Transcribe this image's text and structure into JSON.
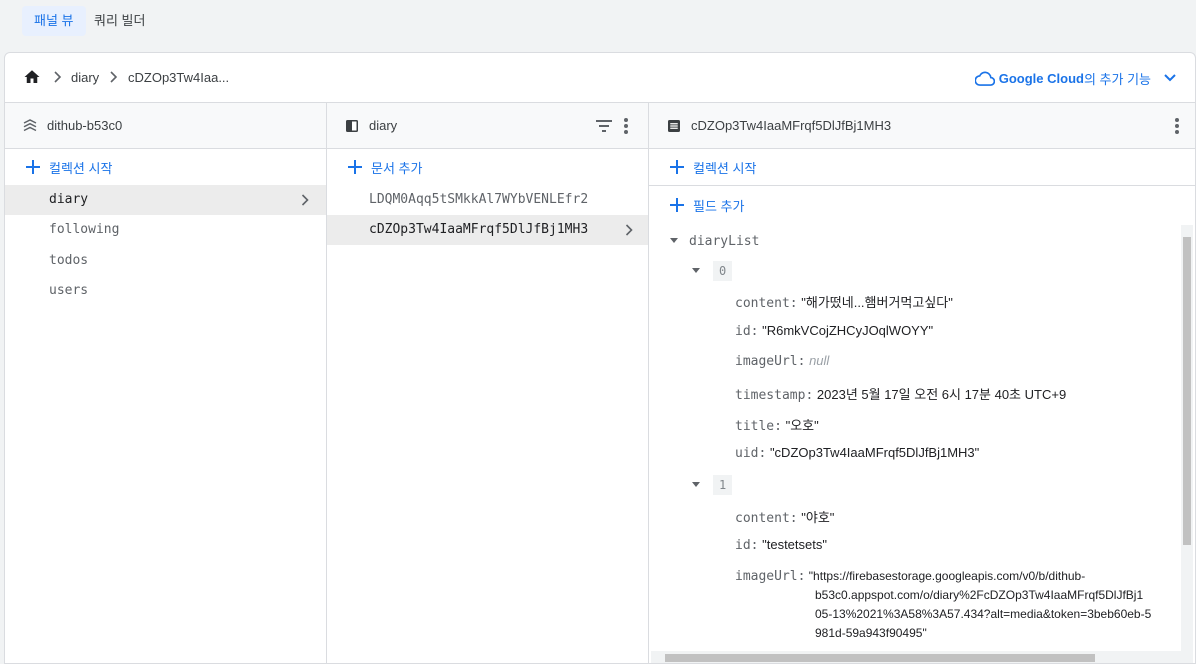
{
  "tabs": [
    "패널 뷰",
    "쿼리 빌더"
  ],
  "breadcrumb": [
    "diary",
    "cDZOp3Tw4Iaa..."
  ],
  "google_cloud": {
    "bold": "Google Cloud",
    "rest": "의 추가 기능"
  },
  "columns": {
    "root": {
      "title": "dithub-b53c0",
      "add_label": "컬렉션 시작",
      "items": [
        "diary",
        "following",
        "todos",
        "users"
      ]
    },
    "collection": {
      "title": "diary",
      "add_label": "문서 추가",
      "items": [
        "LDQM0Aqq5tSMkkAl7WYbVENLEfr2",
        "cDZOp3Tw4IaaMFrqf5DlJfBj1MH3"
      ]
    },
    "document": {
      "title": "cDZOp3Tw4IaaMFrqf5DlJfBj1MH3",
      "add_collection_label": "컬렉션 시작",
      "add_field_label": "필드 추가",
      "root_field": "diaryList",
      "entries": [
        {
          "index": "0",
          "fields": [
            {
              "key": "content:",
              "value": "\"해가떴네...햄버거먹고싶다\""
            },
            {
              "key": "id:",
              "value": "\"R6mkVCojZHCyJOqlWOYY\""
            },
            {
              "key": "imageUrl:",
              "value": "null"
            },
            {
              "key": "timestamp:",
              "value": "2023년 5월 17일 오전 6시 17분 40초 UTC+9"
            },
            {
              "key": "title:",
              "value": "\"오호\""
            },
            {
              "key": "uid:",
              "value": "\"cDZOp3Tw4IaaMFrqf5DlJfBj1MH3\""
            }
          ]
        },
        {
          "index": "1",
          "fields": [
            {
              "key": "content:",
              "value": "\"야호\""
            },
            {
              "key": "id:",
              "value": "\"testetsets\""
            },
            {
              "key": "imageUrl:",
              "value": "\"https://firebasestorage.googleapis.com/v0/b/dithub-"
            },
            {
              "key": "",
              "value": "b53c0.appspot.com/o/diary%2FcDZOp3Tw4IaaMFrqf5DlJfBj1"
            },
            {
              "key": "",
              "value": "05-13%2021%3A58%3A57.434?alt=media&token=3beb60eb-5"
            },
            {
              "key": "",
              "value": "981d-59a943f90495\""
            }
          ]
        }
      ]
    }
  },
  "colors": {
    "accent": "#1a73e8",
    "selected_row": "#ececec",
    "header_bg": "#f8f9fa"
  }
}
